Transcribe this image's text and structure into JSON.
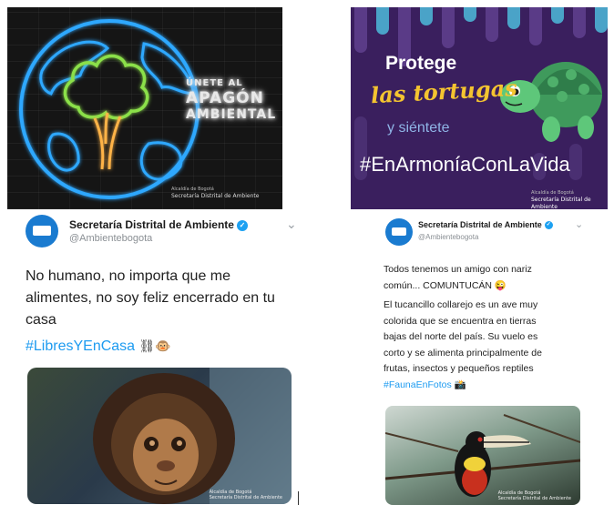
{
  "poster_apagon": {
    "line1": "ÚNETE AL",
    "line2": "APAGÓN",
    "line3": "AMBIENTAL",
    "credit_line1": "Alcaldía de Bogotá",
    "credit_line2": "Secretaría Distrital de Ambiente"
  },
  "poster_tortugas": {
    "line1": "Protege",
    "line2": "las tortugas",
    "line3": "y siéntete",
    "line4": "#EnArmoníaConLaVida",
    "credit_line1": "Alcaldía de Bogotá",
    "credit_line2": "Secretaría Distrital de Ambiente"
  },
  "tweet_left": {
    "account_name": "Secretaría Distrital de Ambiente",
    "verified_glyph": "✓",
    "handle": "@Ambientebogota",
    "chevron": "⌄",
    "text_line1": "No humano, no importa que me",
    "text_line2": "alimentes, no soy feliz encerrado en tu",
    "text_line3": "casa",
    "hashtag": "#LibresYEnCasa",
    "emoji": "⛓🐵",
    "media_credit_line1": "Alcaldía de Bogotá",
    "media_credit_line2": "Secretaría Distrital de Ambiente"
  },
  "tweet_right": {
    "account_name": "Secretaría Distrital de Ambiente",
    "verified_glyph": "✓",
    "handle": "@Ambientebogota",
    "chevron": "⌄",
    "text_line1": "Todos tenemos un amigo con nariz",
    "text_line2": "común... COMUNTUCÁN 😜",
    "text_line3": "El tucancillo collarejo es un ave muy",
    "text_line4": "colorida que se encuentra en tierras",
    "text_line5": "bajas del norte del país. Su vuelo es",
    "text_line6": "corto y se alimenta principalmente de",
    "text_line7": "frutas, insectos y pequeños reptiles",
    "hashtag": "#FaunaEnFotos",
    "emoji": "📸",
    "media_credit_line1": "Alcaldía de Bogotá",
    "media_credit_line2": "Secretaría Distrital de Ambiente"
  },
  "colors": {
    "twitter_blue": "#1d9bf0",
    "neon_blue": "#2ea8ff",
    "neon_green": "#8be04a",
    "neon_orange": "#ffb347",
    "poster_purple": "#3a1f5e",
    "turtle_green": "#5ec77a",
    "title_yellow": "#f4c430"
  }
}
